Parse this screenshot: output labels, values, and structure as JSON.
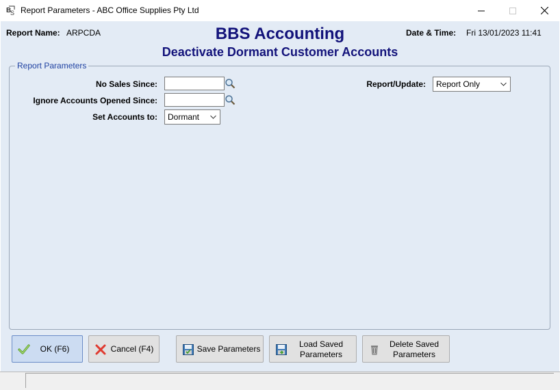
{
  "window": {
    "title": "Report Parameters - ABC Office Supplies Pty Ltd"
  },
  "header": {
    "report_name_label": "Report Name:",
    "report_name_value": "ARPCDA",
    "datetime_label": "Date & Time:",
    "datetime_value": "Fri 13/01/2023 11:41",
    "title": "BBS Accounting",
    "subtitle": "Deactivate Dormant Customer Accounts"
  },
  "params": {
    "group_title": "Report Parameters",
    "no_sales_label": "No Sales Since:",
    "no_sales_value": "",
    "ignore_label": "Ignore Accounts Opened Since:",
    "ignore_value": "",
    "set_accounts_label": "Set Accounts to:",
    "set_accounts_value": "Dormant",
    "report_update_label": "Report/Update:",
    "report_update_value": "Report Only"
  },
  "buttons": {
    "ok": "OK (F6)",
    "cancel": "Cancel (F4)",
    "save": "Save Parameters",
    "load_line1": "Load Saved",
    "load_line2": "Parameters",
    "delete_line1": "Delete Saved",
    "delete_line2": "Parameters"
  },
  "colors": {
    "title_color": "#12127a",
    "group_title_color": "#1c3fa0",
    "client_bg": "#e3ebf5"
  },
  "icons": [
    "app-logo-icon",
    "minimize-icon",
    "maximize-icon",
    "close-icon",
    "magnifier-icon",
    "chevron-down-icon",
    "check-icon",
    "cross-icon",
    "save-icon",
    "load-icon",
    "delete-bin-icon"
  ]
}
